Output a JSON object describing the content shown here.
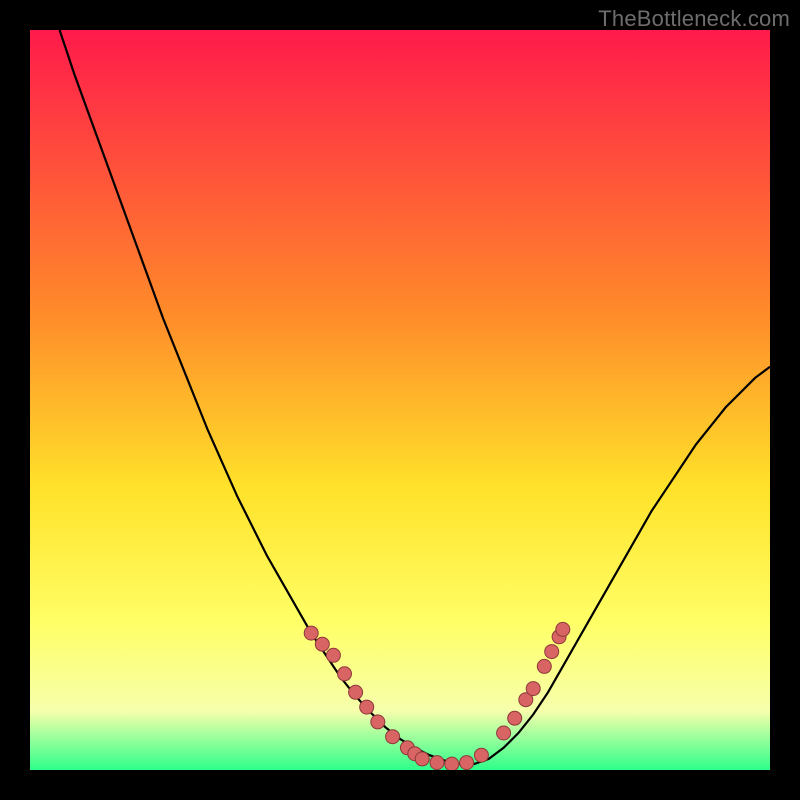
{
  "watermark": "TheBottleneck.com",
  "colors": {
    "gradient_top": "#ff1a4b",
    "gradient_mid1": "#ff8a2a",
    "gradient_mid2": "#ffe22a",
    "gradient_mid3": "#ffff66",
    "gradient_mid4": "#f6ffab",
    "gradient_bottom": "#2dff8a",
    "curve": "#000000",
    "dot_fill": "#d86464",
    "dot_stroke": "#8e3a3a"
  },
  "chart_data": {
    "type": "line",
    "title": "",
    "xlabel": "",
    "ylabel": "",
    "xlim": [
      0,
      100
    ],
    "ylim": [
      0,
      100
    ],
    "curve": {
      "name": "bottleneck-curve",
      "x": [
        4,
        6,
        8,
        10,
        12,
        14,
        16,
        18,
        20,
        22,
        24,
        26,
        28,
        30,
        32,
        34,
        36,
        38,
        40,
        42,
        44,
        46,
        48,
        50,
        52,
        54,
        56,
        58,
        60,
        62,
        64,
        66,
        68,
        70,
        72,
        74,
        76,
        78,
        80,
        82,
        84,
        86,
        88,
        90,
        92,
        94,
        96,
        98,
        100
      ],
      "y": [
        100,
        94,
        88.5,
        83,
        77.5,
        72,
        66.5,
        61,
        56,
        51,
        46,
        41.5,
        37,
        33,
        29,
        25.5,
        22,
        18.5,
        15.5,
        12.5,
        10,
        7.8,
        5.8,
        4.2,
        3,
        2,
        1.3,
        0.8,
        0.8,
        1.5,
        3,
        5,
        7.5,
        10.5,
        14,
        17.5,
        21,
        24.5,
        28,
        31.5,
        35,
        38,
        41,
        44,
        46.5,
        49,
        51,
        53,
        54.5
      ]
    },
    "dots": [
      {
        "x": 38,
        "y": 18.5
      },
      {
        "x": 39.5,
        "y": 17
      },
      {
        "x": 41,
        "y": 15.5
      },
      {
        "x": 42.5,
        "y": 13
      },
      {
        "x": 44,
        "y": 10.5
      },
      {
        "x": 45.5,
        "y": 8.5
      },
      {
        "x": 47,
        "y": 6.5
      },
      {
        "x": 49,
        "y": 4.5
      },
      {
        "x": 51,
        "y": 3
      },
      {
        "x": 52,
        "y": 2.2
      },
      {
        "x": 53,
        "y": 1.5
      },
      {
        "x": 55,
        "y": 1
      },
      {
        "x": 57,
        "y": 0.8
      },
      {
        "x": 59,
        "y": 1
      },
      {
        "x": 61,
        "y": 2
      },
      {
        "x": 64,
        "y": 5
      },
      {
        "x": 65.5,
        "y": 7
      },
      {
        "x": 67,
        "y": 9.5
      },
      {
        "x": 68,
        "y": 11
      },
      {
        "x": 69.5,
        "y": 14
      },
      {
        "x": 70.5,
        "y": 16
      },
      {
        "x": 71.5,
        "y": 18
      },
      {
        "x": 72,
        "y": 19
      }
    ]
  }
}
